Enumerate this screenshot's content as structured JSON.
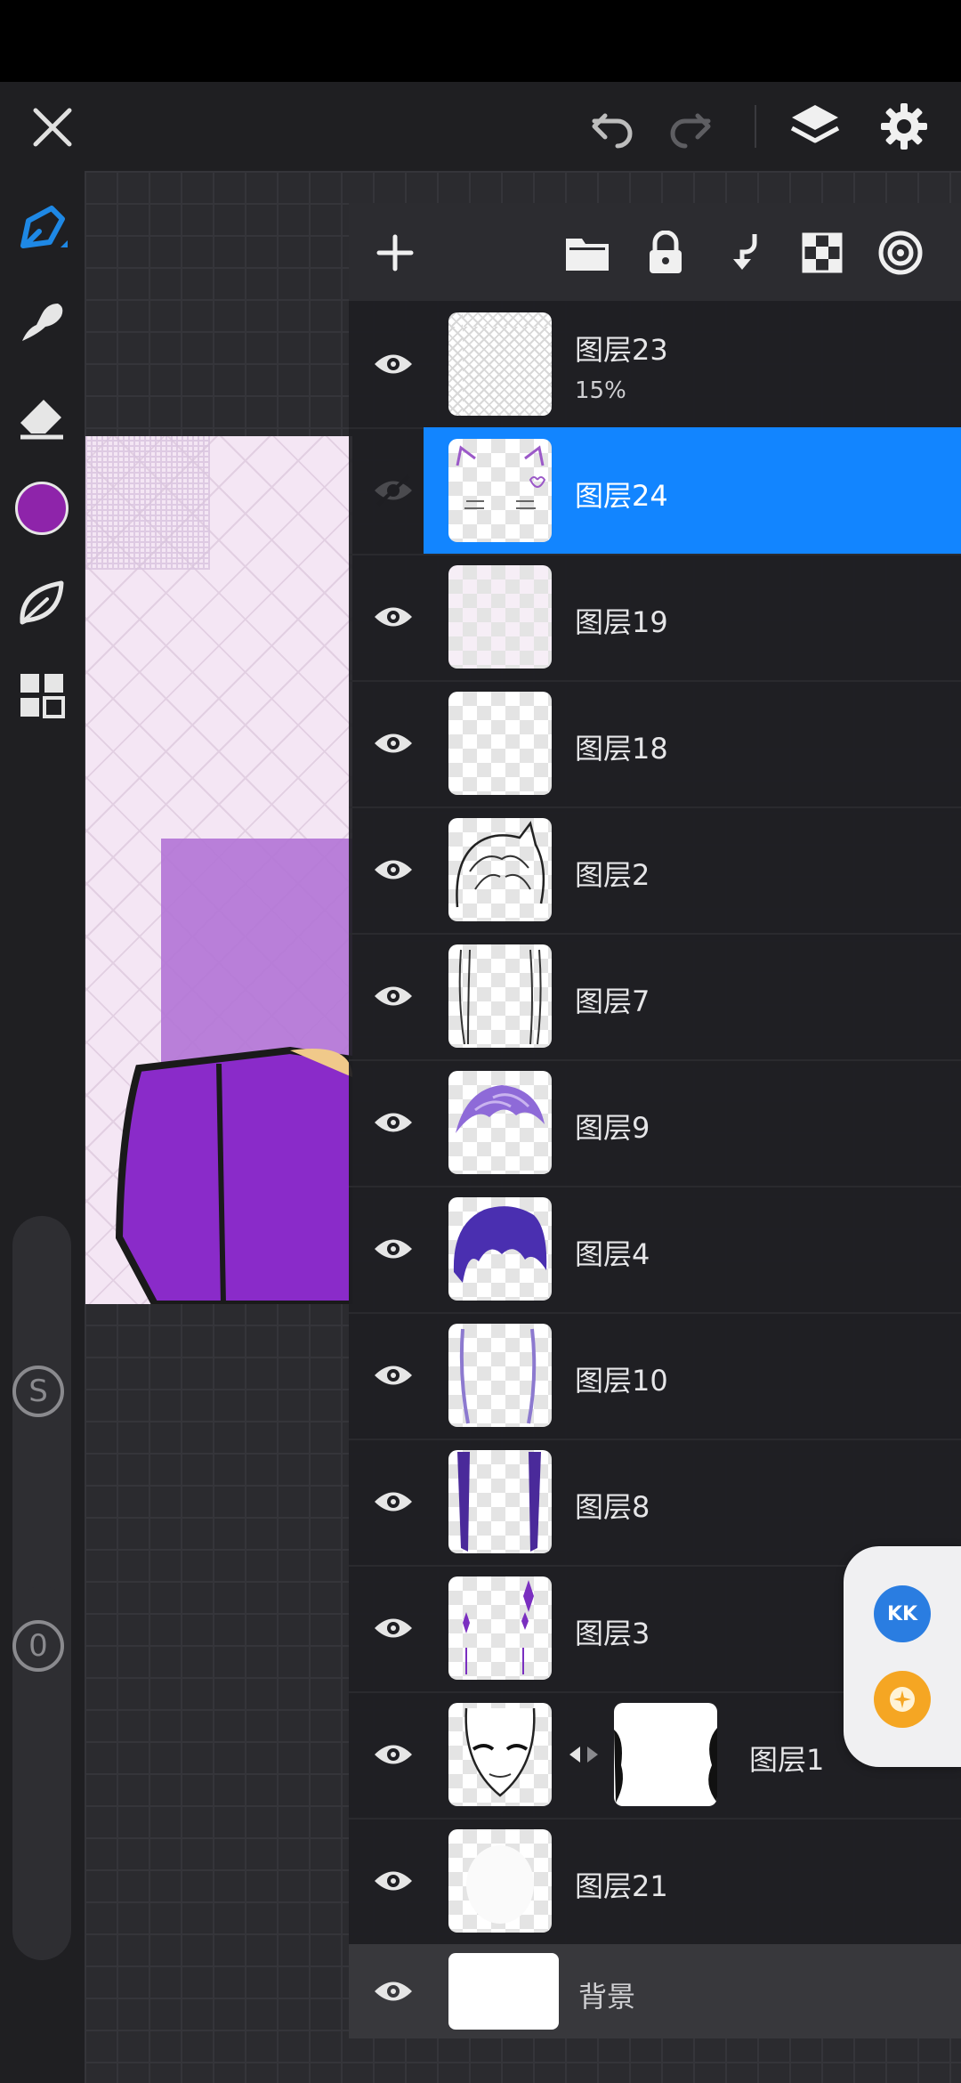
{
  "app": {
    "accent_color": "#1285ff",
    "current_color": "#8e24aa"
  },
  "toolbar": {
    "close_icon": "close-icon",
    "undo_icon": "undo-icon",
    "redo_icon": "redo-icon",
    "layers_icon": "layers-icon",
    "settings_icon": "gear-icon"
  },
  "tools": [
    {
      "name": "brush",
      "icon": "pen-icon",
      "active": true
    },
    {
      "name": "smudge",
      "icon": "smudge-icon"
    },
    {
      "name": "eraser",
      "icon": "eraser-icon"
    },
    {
      "name": "color",
      "icon": "color-swatch"
    },
    {
      "name": "brush-library",
      "icon": "leaf-icon"
    },
    {
      "name": "grid-menu",
      "icon": "grid-icon"
    }
  ],
  "sliders": {
    "size_label": "S",
    "opacity_label": "0"
  },
  "layers_toolbar": [
    "add-layer-icon",
    "folder-icon",
    "lock-icon",
    "merge-down-icon",
    "checkerboard-icon",
    "target-icon"
  ],
  "layers": [
    {
      "name": "图层23",
      "opacity": "15%",
      "visible": true
    },
    {
      "name": "图层24",
      "visible": false,
      "selected": true
    },
    {
      "name": "图层19",
      "visible": true
    },
    {
      "name": "图层18",
      "visible": true
    },
    {
      "name": "图层2",
      "visible": true
    },
    {
      "name": "图层7",
      "visible": true
    },
    {
      "name": "图层9",
      "visible": true
    },
    {
      "name": "图层4",
      "visible": true
    },
    {
      "name": "图层10",
      "visible": true
    },
    {
      "name": "图层8",
      "visible": true
    },
    {
      "name": "图层3",
      "visible": true
    },
    {
      "name": "图层1",
      "visible": true,
      "has_mask": true
    },
    {
      "name": "图层21",
      "visible": true
    }
  ],
  "background_layer": {
    "name": "背景",
    "visible": true
  },
  "floating": {
    "btn1_text": "KK",
    "btn2_icon": "assistant-icon"
  }
}
